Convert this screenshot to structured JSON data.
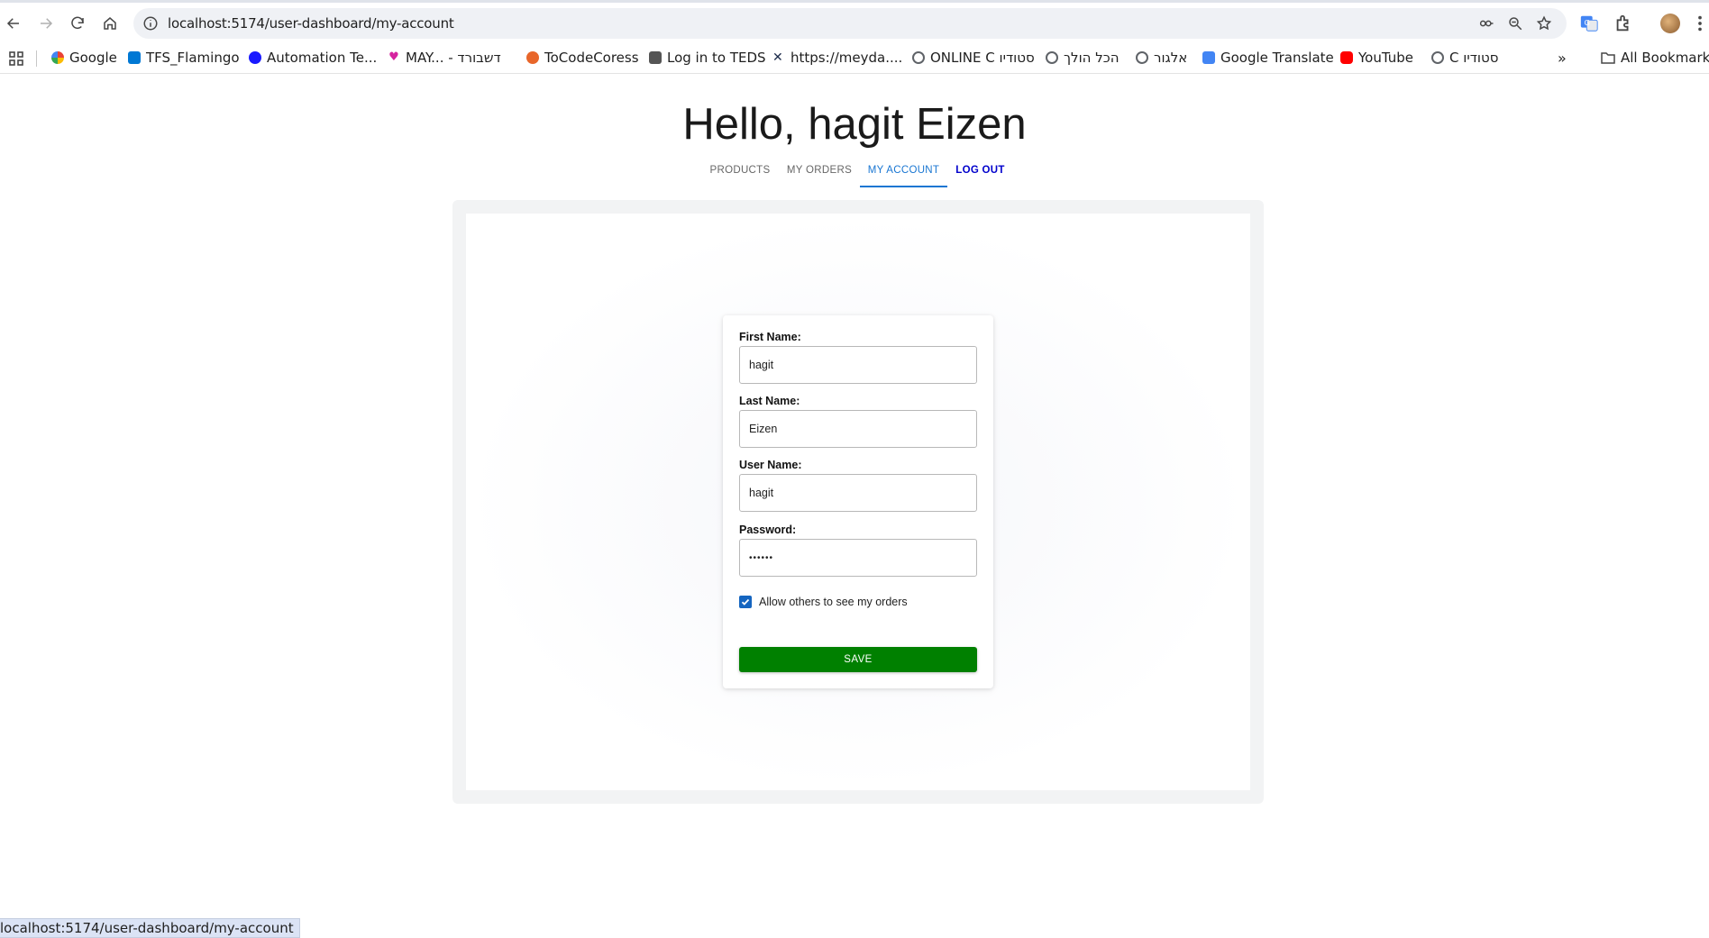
{
  "browser": {
    "url": "localhost:5174/user-dashboard/my-account",
    "bookmarks": [
      {
        "label": "Google",
        "icon": "google-icon",
        "color": "#4285f4"
      },
      {
        "label": "TFS_Flamingo",
        "icon": "azure-devops-icon",
        "color": "#0078d4"
      },
      {
        "label": "Automation Te...",
        "icon": "p-circle-icon",
        "color": "#1a1aff"
      },
      {
        "label": "MAY... - דשבורד",
        "icon": "heart-icon",
        "color": "#d6249f"
      },
      {
        "label": "ToCodeCoress",
        "icon": "tocode-icon",
        "color": "#e8662a"
      },
      {
        "label": "Log in to TEDS",
        "icon": "teds-icon",
        "color": "#555555"
      },
      {
        "label": "https://meyda....",
        "icon": "x-logo-icon",
        "color": "#1b2a4a"
      },
      {
        "label": "ONLINE C סטודיו",
        "icon": "globe-icon",
        "color": "#5f6368"
      },
      {
        "label": "הכל הולך",
        "icon": "globe-icon",
        "color": "#5f6368"
      },
      {
        "label": "אלגור",
        "icon": "globe-icon",
        "color": "#5f6368"
      },
      {
        "label": "Google Translate",
        "icon": "translate-icon",
        "color": "#4285f4"
      },
      {
        "label": "YouTube",
        "icon": "youtube-icon",
        "color": "#ff0000"
      },
      {
        "label": "C סטודיו",
        "icon": "globe-icon",
        "color": "#5f6368"
      }
    ],
    "all_bookmarks_label": "All Bookmarks",
    "status_url": "localhost:5174/user-dashboard/my-account"
  },
  "page": {
    "title": "Hello, hagit Eizen",
    "tabs": [
      {
        "label": "PRODUCTS"
      },
      {
        "label": "MY ORDERS"
      },
      {
        "label": "MY ACCOUNT"
      },
      {
        "label": "LOG OUT"
      }
    ],
    "active_tab": "MY ACCOUNT"
  },
  "form": {
    "first_name_label": "First Name:",
    "first_name_value": "hagit",
    "last_name_label": "Last Name:",
    "last_name_value": "Eizen",
    "user_name_label": "User Name:",
    "user_name_value": "hagit",
    "password_label": "Password:",
    "password_value": "••••••",
    "allow_orders_label": "Allow others to see my orders",
    "allow_orders_checked": true,
    "save_label": "SAVE"
  },
  "colors": {
    "accent": "#1976d2",
    "save_button": "#008000",
    "logout": "#0000cc",
    "checkbox": "#1565c0"
  }
}
